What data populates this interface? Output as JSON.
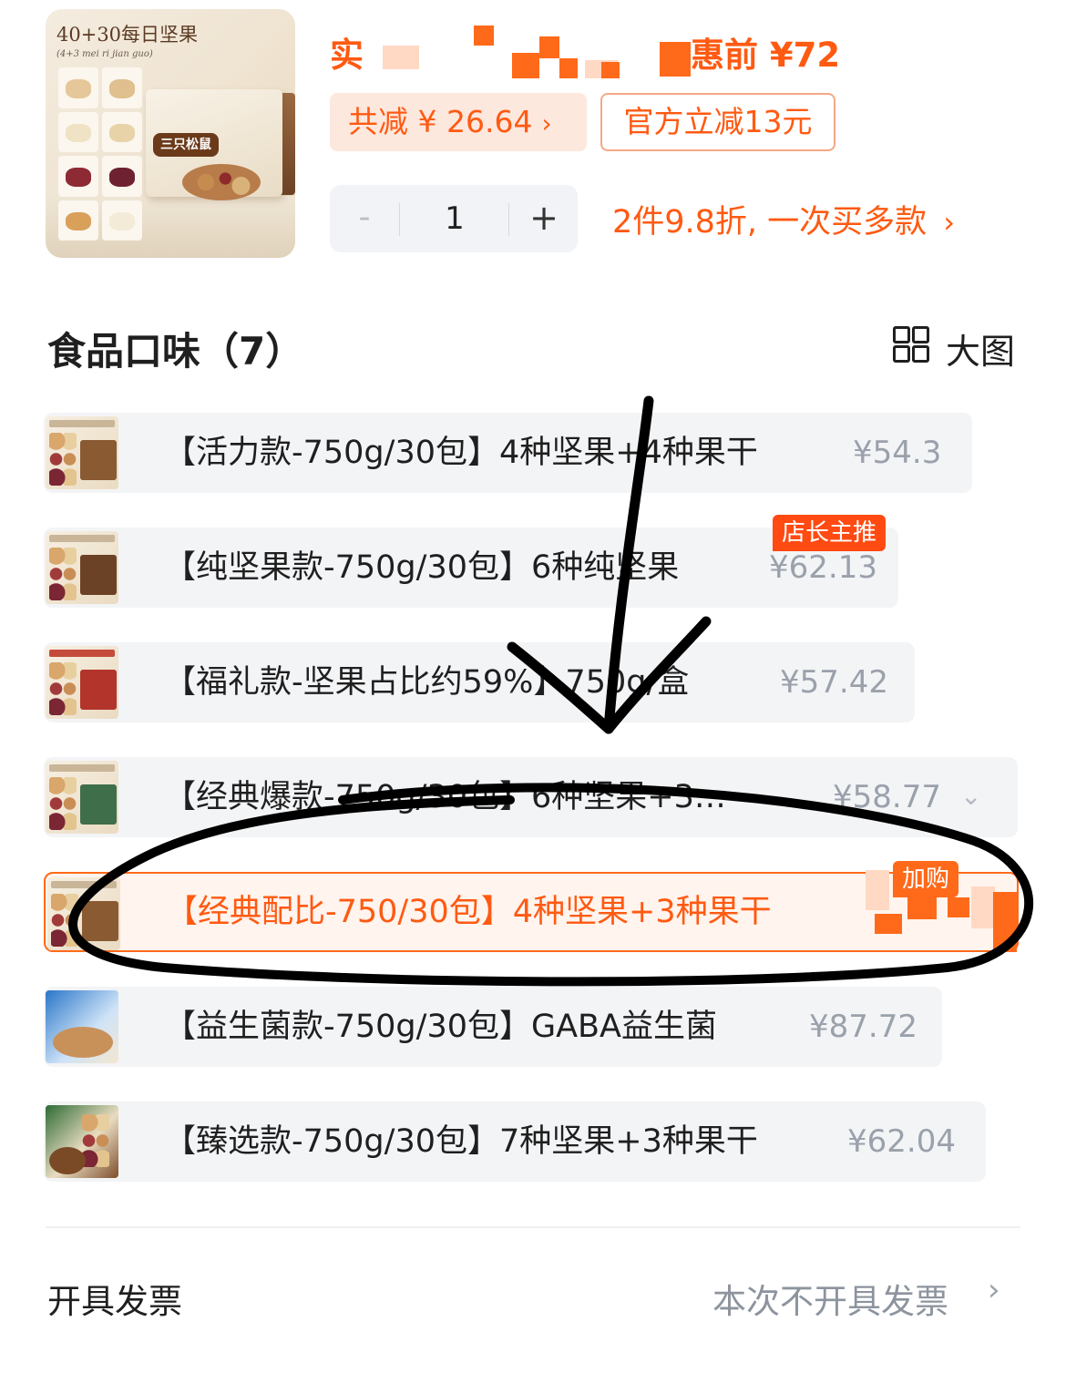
{
  "product": {
    "thumb_title": "40+30每日坚果",
    "thumb_subtitle": "(4+3 mei ri jian guo)",
    "thumb_brand": "三只松鼠",
    "price_prefix": "实",
    "price_suffix": "惠前 ¥72",
    "discount_label": "共减 ¥ 26.64",
    "official_discount": "官方立减13元",
    "quantity": "1",
    "multi_buy_promo": "2件9.8折, 一次买多款"
  },
  "flavors": {
    "title": "食品口味（7）",
    "big_view_label": "大图",
    "options": [
      {
        "label": "【活力款-750g/30包】4种坚果+4种果干",
        "price": "¥54.3"
      },
      {
        "label": "【纯坚果款-750g/30包】6种纯坚果",
        "price": "¥62.13",
        "tag": "店长主推"
      },
      {
        "label": "【福礼款-坚果占比约59%】750g/盒",
        "price": "¥57.42"
      },
      {
        "label": "【经典爆款-750g/30包】6种坚果+3…",
        "price": "¥58.77"
      },
      {
        "label": "【经典配比-750/30包】4种坚果+3种果干",
        "tag": "加购"
      },
      {
        "label": "【益生菌款-750g/30包】GABA益生菌",
        "price": "¥87.72"
      },
      {
        "label": "【臻选款-750g/30包】7种坚果+3种果干",
        "price": "¥62.04"
      }
    ]
  },
  "invoice": {
    "label": "开具发票",
    "value": "本次不开具发票"
  },
  "icons": {
    "chevron": "chevron-right-icon",
    "grid": "grid-view-icon",
    "expand": "chevron-down-icon"
  },
  "colors": {
    "accent": "#ff5a12",
    "tag_bg": "#ff4a12",
    "selected_bg": "#fff4ee",
    "option_bg": "#f3f4f6",
    "muted_price": "#9aa1ab"
  }
}
